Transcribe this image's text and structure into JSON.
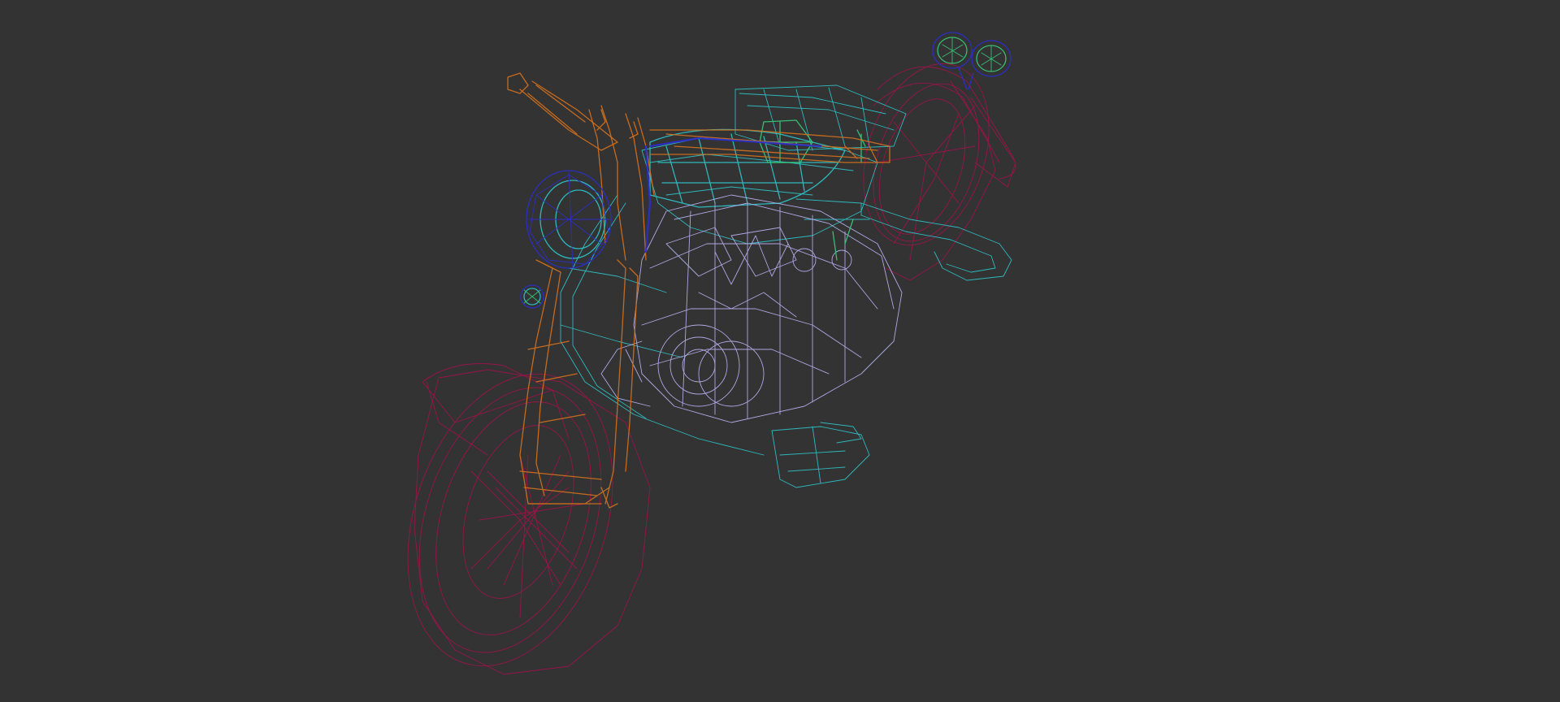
{
  "viewport": {
    "shading": "wireframe",
    "background": "#333333"
  },
  "model": {
    "subject": "motorcycle",
    "parts": [
      {
        "name": "front-wheel",
        "color": "#a0124a"
      },
      {
        "name": "rear-wheel",
        "color": "#a0124a"
      },
      {
        "name": "front-fork",
        "color": "#d2701e"
      },
      {
        "name": "handlebar",
        "color": "#d2701e"
      },
      {
        "name": "headlight",
        "color": "#2b2ecb"
      },
      {
        "name": "gauges",
        "color": "#2b2ecb"
      },
      {
        "name": "fuel-tank",
        "color": "#2fc3c8"
      },
      {
        "name": "frame",
        "color": "#2fc3c8"
      },
      {
        "name": "engine",
        "color": "#b9b0f0"
      },
      {
        "name": "seat",
        "color": "#2fc3c8"
      },
      {
        "name": "exhaust",
        "color": "#2fc3c8"
      },
      {
        "name": "footrest",
        "color": "#2fc3c8"
      },
      {
        "name": "carburetor",
        "color": "#38c978"
      }
    ]
  }
}
